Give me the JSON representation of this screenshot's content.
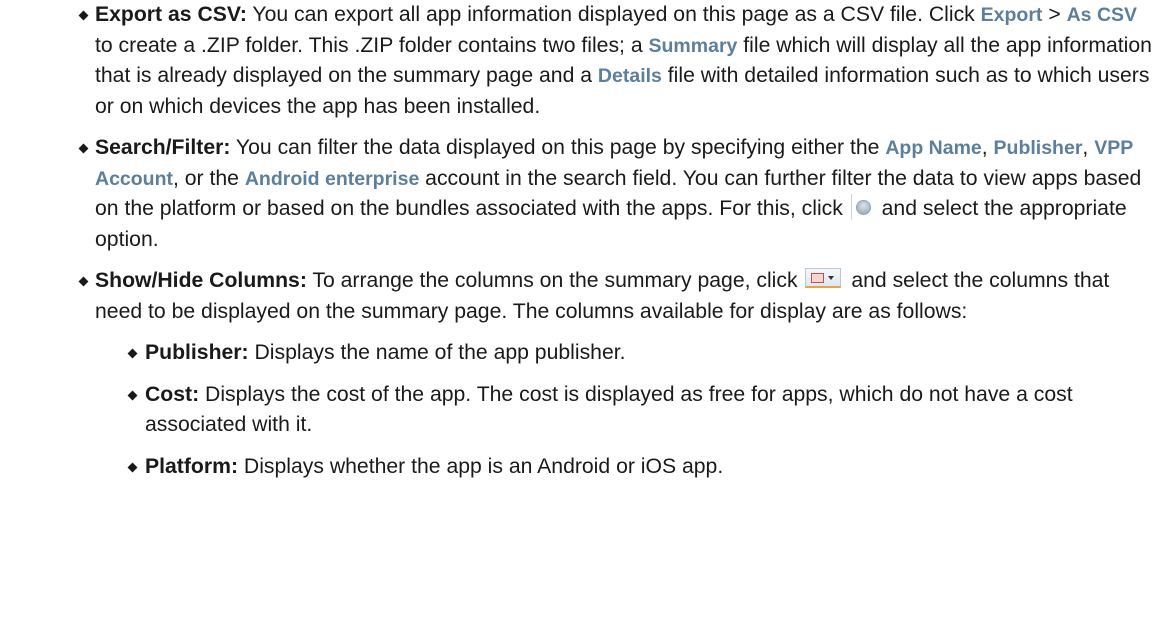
{
  "items": [
    {
      "term": "Export as CSV:",
      "t1": " You can export all app information displayed on this page as a CSV file. Click ",
      "ui1": "Export",
      "t2": " > ",
      "ui2": "As CSV",
      "t3": " to create a .ZIP folder. This .ZIP folder contains two files; a ",
      "ui3": "Summary",
      "t4": " file which will display all the app information that is already displayed on the summary page and a ",
      "ui4": "Details",
      "t5": " file with detailed information such as to which users or on which devices the app has been installed."
    },
    {
      "term": "Search/Filter:",
      "t1": " You can filter the data displayed on this page by specifying either the ",
      "ui1": "App Name",
      "t2": ", ",
      "ui2": "Publisher",
      "t3": ", ",
      "ui3": "VPP Account",
      "t4": ", or the ",
      "ui4": "Android enterprise",
      "t5": " account in the search field. You can further filter the data to view apps based on the platform or based on the bundles associated with the apps. For this, click ",
      "t6": " and select the appropriate option.",
      "icon": "filter-icon"
    },
    {
      "term": "Show/Hide Columns:",
      "t1": " To arrange the columns on the summary page, click ",
      "t2": " and select the columns that need to be displayed on the summary page. The columns available for display are as follows:",
      "icon": "columns-icon",
      "sub": [
        {
          "term": "Publisher:",
          "text": " Displays the name of the app publisher."
        },
        {
          "term": "Cost:",
          "text": " Displays the cost of the app. The cost is displayed as free for apps, which do not have a cost associated with it."
        },
        {
          "term": "Platform:",
          "text": " Displays whether the app is an Android or iOS app."
        }
      ]
    }
  ]
}
